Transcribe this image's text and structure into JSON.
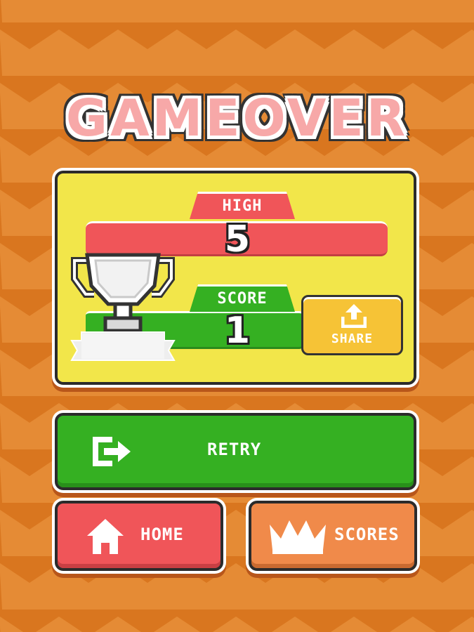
{
  "title": "GAMEOVER",
  "panel": {
    "high_label": "HIGH",
    "high_value": "5",
    "score_label": "SCORE",
    "score_value": "1",
    "share_label": "SHARE"
  },
  "buttons": {
    "retry_label": "RETRY",
    "home_label": "HOME",
    "scores_label": "SCORES"
  },
  "colors": {
    "background": "#d9761f",
    "background_wave": "#e58b35",
    "panel": "#f2e64a",
    "red": "#f05559",
    "green": "#35b022",
    "orange": "#f08a4a",
    "yellow": "#f6c336",
    "title_pink": "#f7a8a8"
  },
  "icons": {
    "trophy": "trophy-icon",
    "share": "share-icon",
    "retry": "retry-icon",
    "home": "home-icon",
    "scores": "crown-icon"
  }
}
